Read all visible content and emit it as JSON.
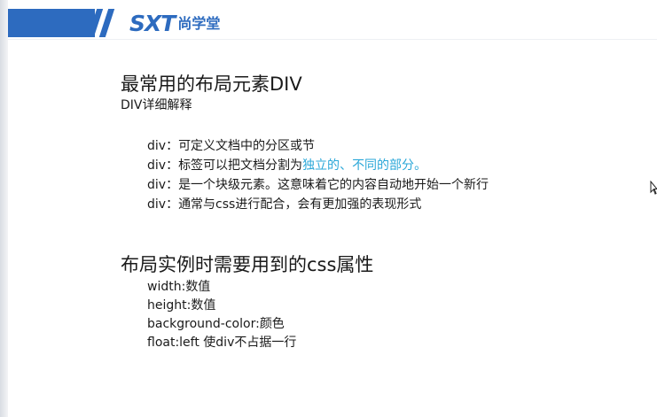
{
  "header": {
    "logo_mark": "SXT",
    "logo_text": "尚学堂",
    "brand_color": "#2d6bbf"
  },
  "slide": {
    "title": "最常用的布局元素DIV",
    "subtitle": "DIV详细解释",
    "bullets": [
      {
        "prefix": "div",
        "sep": "：",
        "text": "可定义文档中的分区或节"
      },
      {
        "prefix": "div",
        "sep": "：",
        "text_a": "标签可以把文档分割为",
        "hl_1": "独立的",
        "text_b": "、",
        "hl_2": "不同的部分",
        "text_c": "。"
      },
      {
        "prefix": "div",
        "sep": "：",
        "text": "是一个块级元素。这意味着它的内容自动地开始一个新行"
      },
      {
        "prefix": "div",
        "sep": "：",
        "text": "通常与css进行配合，会有更加强的表现形式"
      }
    ],
    "highlight_color": "#2aa7d8",
    "section2_title": "布局实例时需要用到的css属性",
    "properties": [
      {
        "name": "width",
        "sep": ":",
        "value": "数值"
      },
      {
        "name": "height",
        "sep": ":",
        "value": "数值"
      },
      {
        "name": "background-color",
        "sep": ":",
        "value": "颜色"
      },
      {
        "name": "float",
        "sep": ":",
        "value": "left 使div不占据一行"
      }
    ]
  },
  "cursor_icon": "mouse-pointer-icon"
}
